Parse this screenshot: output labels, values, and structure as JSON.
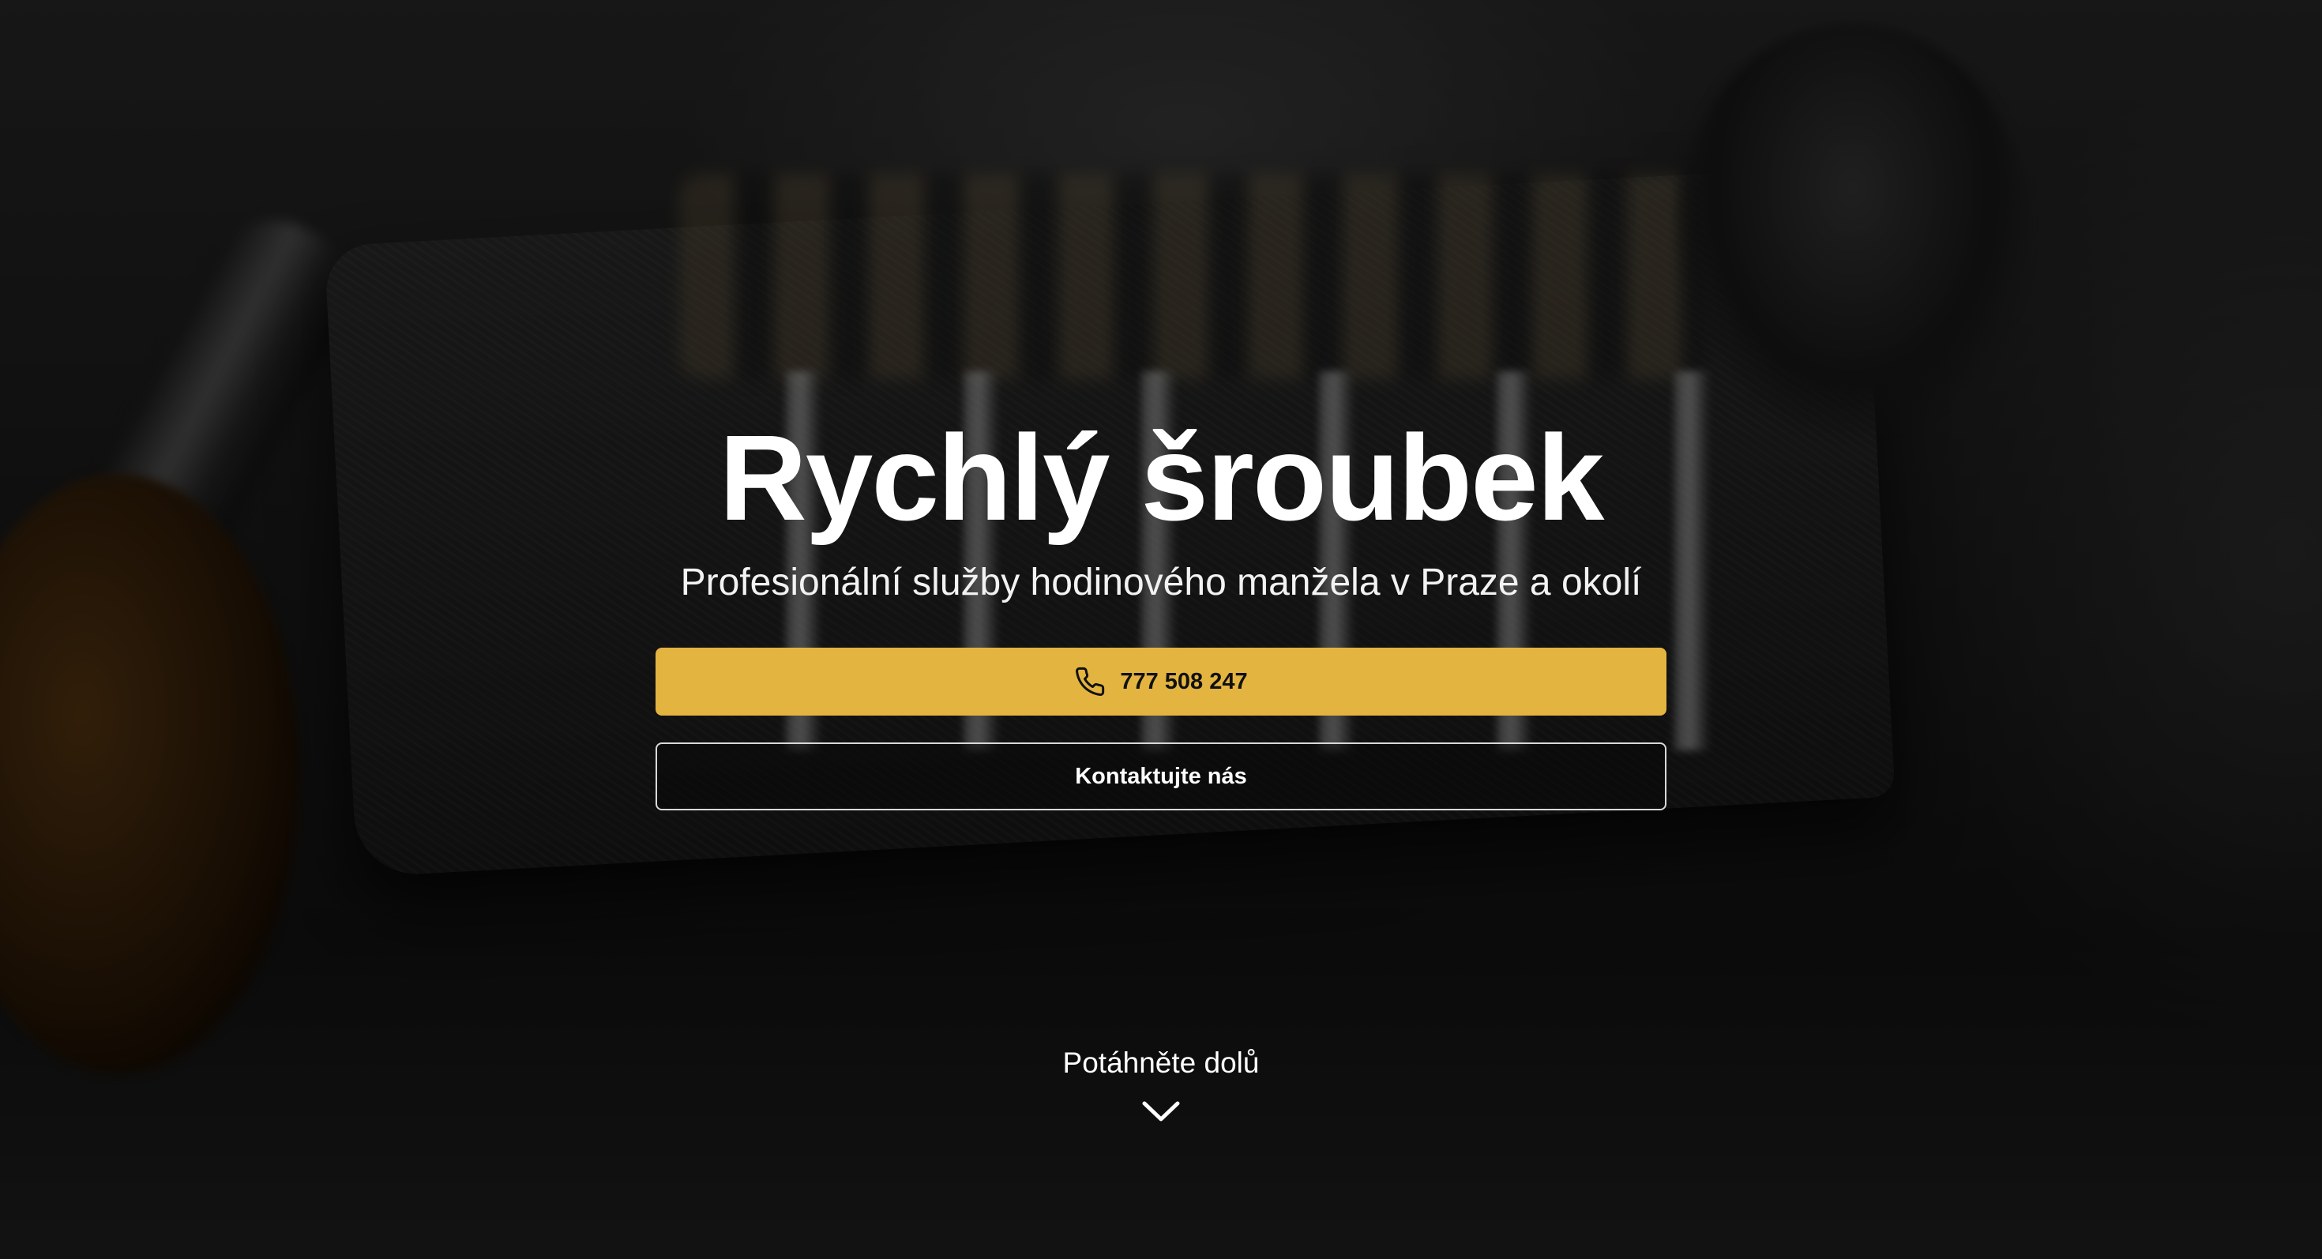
{
  "hero": {
    "title": "Rychlý šroubek",
    "subtitle": "Profesionální služby hodinového manžela v Praze a okolí",
    "phone_button_label": "777 508 247",
    "phone_icon": "phone-icon",
    "contact_button_label": "Kontaktujte nás",
    "scroll_hint": "Potáhněte dolů",
    "scroll_icon": "chevron-down-icon"
  },
  "colors": {
    "accent": "#e3b440",
    "text_primary": "#ffffff",
    "button_text_dark": "#111111"
  }
}
